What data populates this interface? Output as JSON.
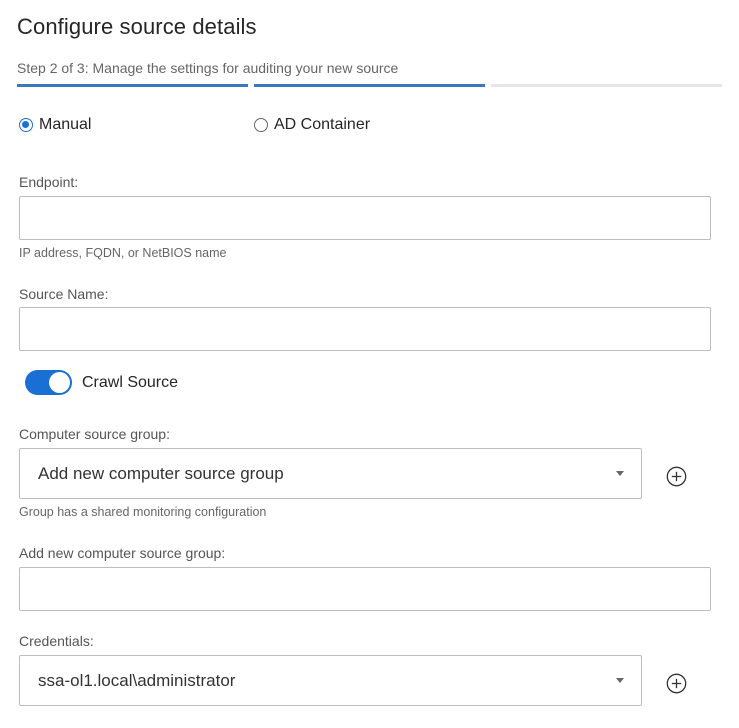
{
  "header": {
    "title": "Configure source details",
    "step": "Step 2 of 3: Manage the settings for auditing your new source"
  },
  "progress": {
    "total_steps": 3,
    "current_step": 2
  },
  "source_type": {
    "options": [
      "Manual",
      "AD Container"
    ],
    "selected": "Manual"
  },
  "endpoint": {
    "label": "Endpoint:",
    "value": "",
    "helper": "IP address, FQDN, or NetBIOS name"
  },
  "source_name": {
    "label": "Source Name:",
    "value": ""
  },
  "crawl_source": {
    "label": "Crawl Source",
    "enabled": true
  },
  "computer_source_group": {
    "label": "Computer source group:",
    "selected": "Add new computer source group",
    "helper": "Group has a shared monitoring configuration"
  },
  "new_group": {
    "label": "Add new computer source group:",
    "value": ""
  },
  "credentials": {
    "label": "Credentials:",
    "selected": "ssa-ol1.local\\administrator"
  },
  "colors": {
    "accent": "#1a6fd4",
    "progress_active": "#3a76c4",
    "progress_inactive": "#e6e6e6"
  },
  "icons": {
    "add": "plus-circle-icon",
    "dropdown": "caret-down-icon"
  }
}
